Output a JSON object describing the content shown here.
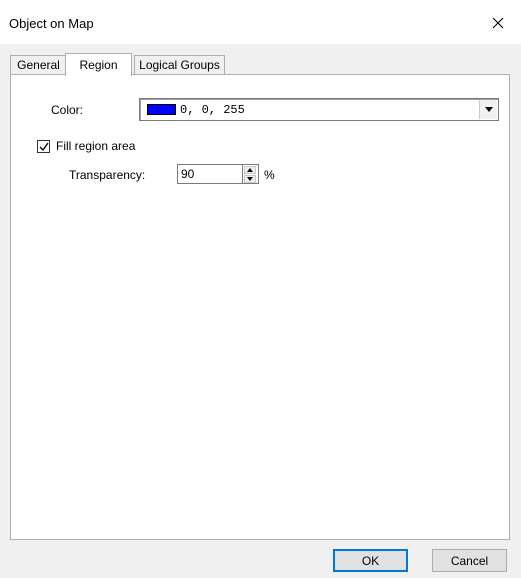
{
  "window": {
    "title": "Object on Map"
  },
  "tabs": [
    {
      "label": "General",
      "active": false
    },
    {
      "label": "Region",
      "active": true
    },
    {
      "label": "Logical Groups",
      "active": false
    }
  ],
  "region": {
    "color_label": "Color:",
    "color_value": "0, 0, 255",
    "color_swatch": "#0000ff",
    "fill_label": "Fill region area",
    "fill_checked": true,
    "transparency_label": "Transparency:",
    "transparency_value": "90",
    "transparency_unit": "%"
  },
  "buttons": {
    "ok": "OK",
    "cancel": "Cancel"
  },
  "icons": {
    "close": "close-icon",
    "dropdown": "dropdown-arrow-icon",
    "check": "checkmark-icon",
    "spin_up": "spin-up-icon",
    "spin_down": "spin-down-icon"
  }
}
